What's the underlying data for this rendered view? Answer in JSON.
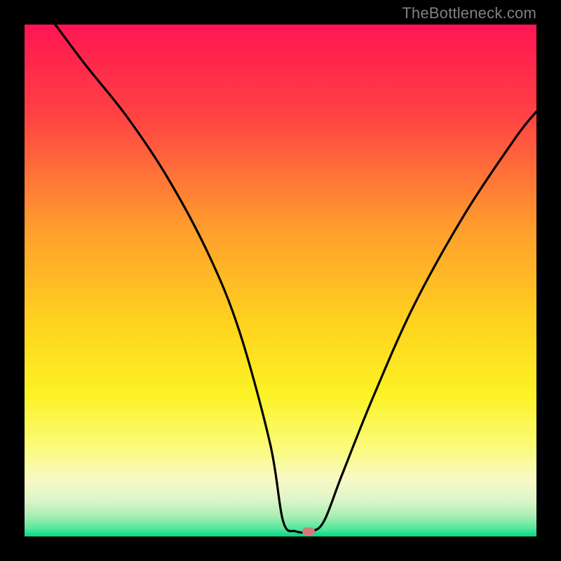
{
  "attribution": "TheBottleneck.com",
  "marker": {
    "x_pct": 55.5,
    "y_pct": 99.0,
    "color": "#cf7d78"
  },
  "gradient_stops": [
    {
      "pct": 0,
      "color": "#ff1552"
    },
    {
      "pct": 18,
      "color": "#ff4343"
    },
    {
      "pct": 40,
      "color": "#ff9e2d"
    },
    {
      "pct": 58,
      "color": "#ffd21f"
    },
    {
      "pct": 72,
      "color": "#fcf224"
    },
    {
      "pct": 82,
      "color": "#fbfb74"
    },
    {
      "pct": 89,
      "color": "#f8f9c6"
    },
    {
      "pct": 93,
      "color": "#dcf5c8"
    },
    {
      "pct": 96,
      "color": "#a9eeb5"
    },
    {
      "pct": 98.5,
      "color": "#53e69c"
    },
    {
      "pct": 100,
      "color": "#00d886"
    }
  ],
  "chart_data": {
    "type": "line",
    "title": "",
    "xlabel": "",
    "ylabel": "",
    "xlim": [
      0,
      100
    ],
    "ylim": [
      0,
      100
    ],
    "series": [
      {
        "name": "bottleneck-curve",
        "x": [
          0,
          6,
          12,
          20,
          28,
          36,
          42,
          48,
          50.5,
          53,
          56,
          58.5,
          62,
          68,
          76,
          86,
          96,
          100
        ],
        "y": [
          108,
          100,
          92,
          82,
          70,
          55,
          40,
          18,
          3,
          1,
          1,
          3,
          12,
          27,
          45,
          63,
          78,
          83
        ]
      }
    ],
    "marker_point": {
      "x": 55.5,
      "y": 1
    }
  }
}
